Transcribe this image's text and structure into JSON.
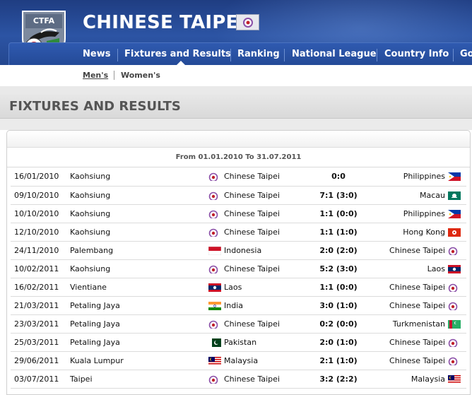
{
  "header": {
    "site_title": "CHINESE TAIPEI",
    "logo_text": "CTFA",
    "logo_icon": "ctfa-shield-logo",
    "title_flag_icon": "chinese-taipei-flag-icon"
  },
  "nav": {
    "items": [
      {
        "label": "News"
      },
      {
        "label": "Fixtures and Results"
      },
      {
        "label": "Ranking"
      },
      {
        "label": "National League"
      },
      {
        "label": "Country Info"
      },
      {
        "label": "Go"
      }
    ]
  },
  "subnav": {
    "items": [
      {
        "label": "Men's",
        "active": true
      },
      {
        "label": "Women's",
        "active": false
      }
    ]
  },
  "page": {
    "title": "FIXTURES AND RESULTS"
  },
  "results": {
    "period": "From 01.01.2010 To 31.07.2011",
    "rows": [
      {
        "date": "16/01/2010",
        "venue": "Kaohsiung",
        "home": "Chinese Taipei",
        "home_flag": "ctfa",
        "score": "0:0",
        "away": "Philippines",
        "away_flag": "phi"
      },
      {
        "date": "09/10/2010",
        "venue": "Kaohsiung",
        "home": "Chinese Taipei",
        "home_flag": "ctfa",
        "score": "7:1 (3:0)",
        "away": "Macau",
        "away_flag": "mac"
      },
      {
        "date": "10/10/2010",
        "venue": "Kaohsiung",
        "home": "Chinese Taipei",
        "home_flag": "ctfa",
        "score": "1:1 (0:0)",
        "away": "Philippines",
        "away_flag": "phi"
      },
      {
        "date": "12/10/2010",
        "venue": "Kaohsiung",
        "home": "Chinese Taipei",
        "home_flag": "ctfa",
        "score": "1:1 (1:0)",
        "away": "Hong Kong",
        "away_flag": "hkg"
      },
      {
        "date": "24/11/2010",
        "venue": "Palembang",
        "home": "Indonesia",
        "home_flag": "idn",
        "score": "2:0 (2:0)",
        "away": "Chinese Taipei",
        "away_flag": "ctfa"
      },
      {
        "date": "10/02/2011",
        "venue": "Kaohsiung",
        "home": "Chinese Taipei",
        "home_flag": "ctfa",
        "score": "5:2 (3:0)",
        "away": "Laos",
        "away_flag": "lao"
      },
      {
        "date": "16/02/2011",
        "venue": "Vientiane",
        "home": "Laos",
        "home_flag": "lao",
        "score": "1:1 (0:0)",
        "away": "Chinese Taipei",
        "away_flag": "ctfa"
      },
      {
        "date": "21/03/2011",
        "venue": "Petaling Jaya",
        "home": "India",
        "home_flag": "ind",
        "score": "3:0 (1:0)",
        "away": "Chinese Taipei",
        "away_flag": "ctfa"
      },
      {
        "date": "23/03/2011",
        "venue": "Petaling Jaya",
        "home": "Chinese Taipei",
        "home_flag": "ctfa",
        "score": "0:2 (0:0)",
        "away": "Turkmenistan",
        "away_flag": "tkm"
      },
      {
        "date": "25/03/2011",
        "venue": "Petaling Jaya",
        "home": "Pakistan",
        "home_flag": "pak",
        "score": "2:0 (1:0)",
        "away": "Chinese Taipei",
        "away_flag": "ctfa"
      },
      {
        "date": "29/06/2011",
        "venue": "Kuala Lumpur",
        "home": "Malaysia",
        "home_flag": "mas",
        "score": "2:1 (1:0)",
        "away": "Chinese Taipei",
        "away_flag": "ctfa"
      },
      {
        "date": "03/07/2011",
        "venue": "Taipei",
        "home": "Chinese Taipei",
        "home_flag": "ctfa",
        "score": "3:2 (2:2)",
        "away": "Malaysia",
        "away_flag": "mas"
      }
    ]
  },
  "colors": {
    "header_blue": "#2c54a4",
    "nav_blue": "#244a97",
    "text_dark": "#111111",
    "section_grey": "#dddddd"
  }
}
